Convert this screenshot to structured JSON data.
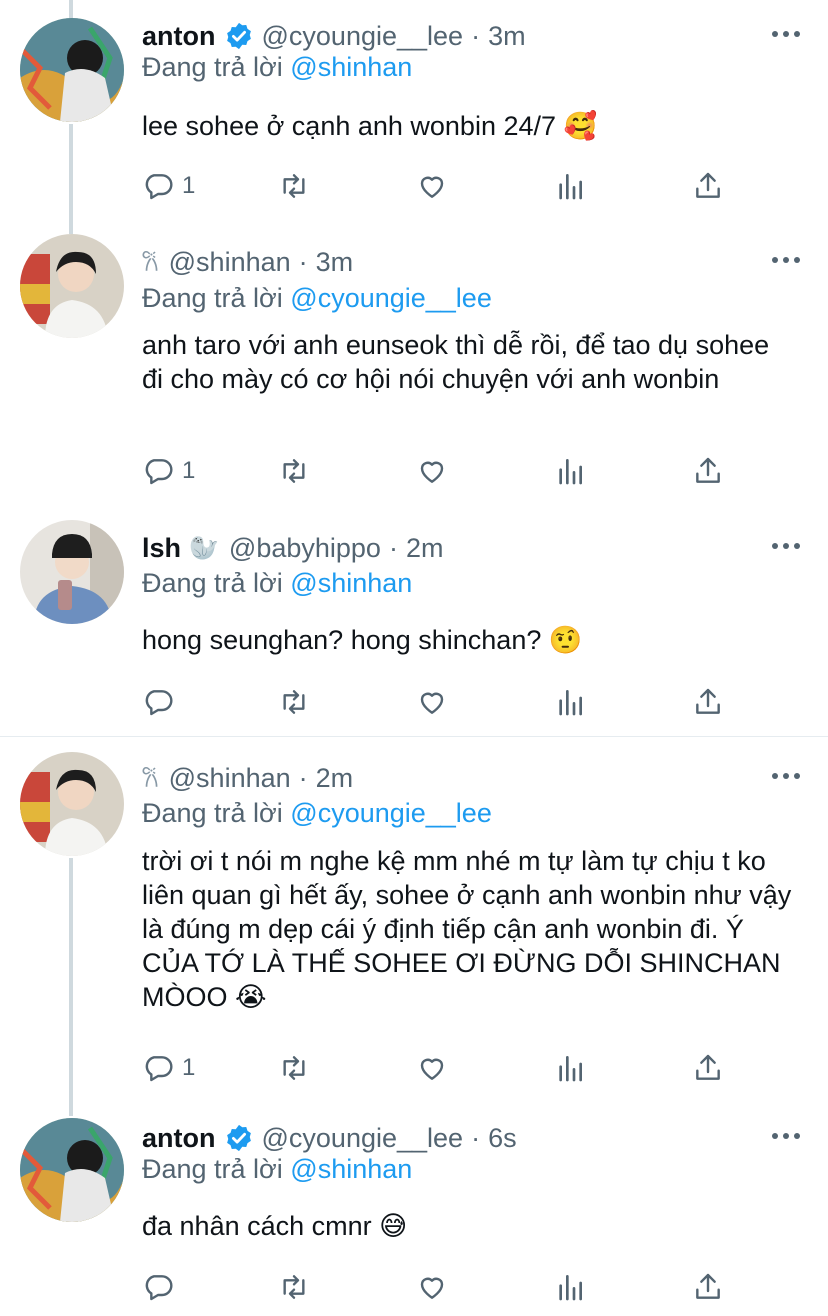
{
  "reply_prefix": "Đang trả lời",
  "tweets": [
    {
      "name": "anton",
      "verified": true,
      "handle": "@cyoungie__lee",
      "time": "3m",
      "reply_to": "@shinhan",
      "text": "lee sohee ở cạnh anh wonbin 24/7 🥰",
      "reply_count": "1"
    },
    {
      "name_emoji": "𐙚",
      "handle": "@shinhan",
      "time": "3m",
      "reply_to": "@cyoungie__lee",
      "text": "anh taro với anh eunseok thì dễ rồi, để tao dụ sohee đi cho mày có cơ hội nói chuyện với anh wonbin",
      "reply_count": "1"
    },
    {
      "name": "lsh",
      "name_emoji": "🦭",
      "handle": "@babyhippo",
      "time": "2m",
      "reply_to": "@shinhan",
      "text": "hong seunghan? hong shinchan? 🤨",
      "reply_count": ""
    },
    {
      "name_emoji": "𐙚",
      "handle": "@shinhan",
      "time": "2m",
      "reply_to": "@cyoungie__lee",
      "text": "trời ơi t nói m nghe kệ mm nhé m tự làm tự chịu t ko liên quan gì hết ấy, sohee ở cạnh anh wonbin như vậy là đúng m dẹp cái ý định tiếp cận anh wonbin đi. Ý CỦA TỚ LÀ THẾ SOHEE ƠI ĐỪNG DỖI SHINCHAN MÒOO 😭",
      "reply_count": "1"
    },
    {
      "name": "anton",
      "verified": true,
      "handle": "@cyoungie__lee",
      "time": "6s",
      "reply_to": "@shinhan",
      "text": "đa nhân cách cmnr 😅",
      "reply_count": ""
    }
  ],
  "colors": {
    "link": "#1d9bf0",
    "secondary": "#536471",
    "verified": "#1d9bf0"
  },
  "icons": [
    "reply-icon",
    "retweet-icon",
    "like-icon",
    "analytics-icon",
    "share-icon",
    "more-icon",
    "verified-icon"
  ]
}
